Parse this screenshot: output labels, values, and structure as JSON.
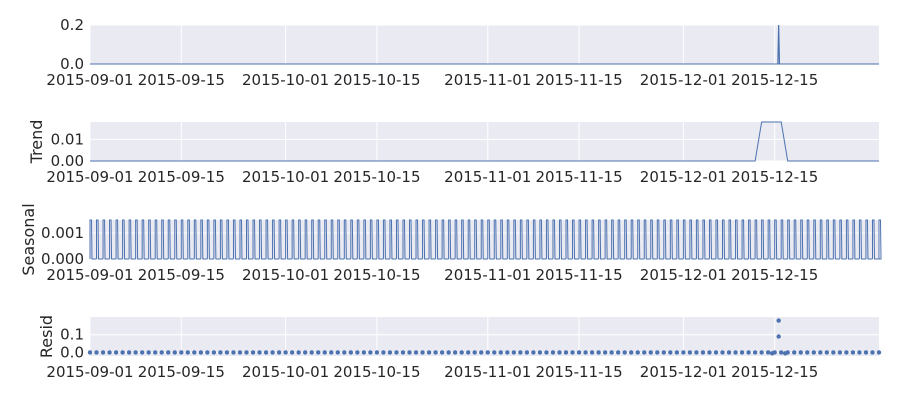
{
  "chart_data": [
    {
      "type": "line",
      "panel": "observed",
      "ylabel": "",
      "ylim": [
        0,
        0.2
      ],
      "yticks": [
        0.0,
        0.2
      ],
      "ytick_labels": [
        "0.0",
        "0.2"
      ],
      "xlim": [
        "2015-09-01",
        "2015-12-31"
      ],
      "xticks": [
        "2015-09-01",
        "2015-09-15",
        "2015-10-01",
        "2015-10-15",
        "2015-11-01",
        "2015-11-15",
        "2015-12-01",
        "2015-12-15"
      ],
      "grid": true,
      "series": [
        {
          "baseline": 0,
          "spikes": [
            {
              "x": "2015-12-15",
              "y": 0.2
            }
          ]
        }
      ]
    },
    {
      "type": "line",
      "panel": "trend",
      "ylabel": "Trend",
      "ylim": [
        0,
        0.018
      ],
      "yticks": [
        0.0,
        0.01
      ],
      "ytick_labels": [
        "0.00",
        "0.01"
      ],
      "xlim": [
        "2015-09-01",
        "2015-12-31"
      ],
      "xticks": [
        "2015-09-01",
        "2015-09-15",
        "2015-10-01",
        "2015-10-15",
        "2015-11-01",
        "2015-11-15",
        "2015-12-01",
        "2015-12-15"
      ],
      "grid": true,
      "series": [
        {
          "points": [
            [
              "2015-09-01",
              0
            ],
            [
              "2015-12-12",
              0
            ],
            [
              "2015-12-13",
              0.018
            ],
            [
              "2015-12-16",
              0.018
            ],
            [
              "2015-12-17",
              0
            ],
            [
              "2015-12-31",
              0
            ]
          ]
        }
      ]
    },
    {
      "type": "line",
      "panel": "seasonal",
      "ylabel": "Seasonal",
      "ylim": [
        0,
        0.0015
      ],
      "yticks": [
        0.0,
        0.001
      ],
      "ytick_labels": [
        "0.000",
        "0.001"
      ],
      "xlim": [
        "2015-09-01",
        "2015-12-31"
      ],
      "xticks": [
        "2015-09-01",
        "2015-09-15",
        "2015-10-01",
        "2015-10-15",
        "2015-11-01",
        "2015-11-15",
        "2015-12-01",
        "2015-12-15"
      ],
      "grid": true,
      "series": [
        {
          "period_days": 1,
          "high": 0.0015,
          "low": 0
        }
      ]
    },
    {
      "type": "scatter",
      "panel": "resid",
      "ylabel": "Resid",
      "ylim": [
        -0.02,
        0.2
      ],
      "yticks": [
        0.0,
        0.1
      ],
      "ytick_labels": [
        "0.0",
        "0.1"
      ],
      "xlim": [
        "2015-09-01",
        "2015-12-31"
      ],
      "xticks": [
        "2015-09-01",
        "2015-09-15",
        "2015-10-01",
        "2015-10-15",
        "2015-11-01",
        "2015-11-15",
        "2015-12-01",
        "2015-12-15"
      ],
      "grid": true,
      "series": [
        {
          "baseline": 0,
          "outliers": [
            {
              "x": "2015-12-15",
              "y": 0.18
            },
            {
              "x": "2015-12-15",
              "y": 0.09
            },
            {
              "x": "2015-12-14",
              "y": -0.005
            },
            {
              "x": "2015-12-16",
              "y": -0.005
            }
          ]
        }
      ]
    }
  ],
  "style": {
    "panel_bg": "#eaeaf2",
    "grid_color": "#ffffff",
    "line_color": "#4c72b0",
    "text_color": "#262626"
  }
}
